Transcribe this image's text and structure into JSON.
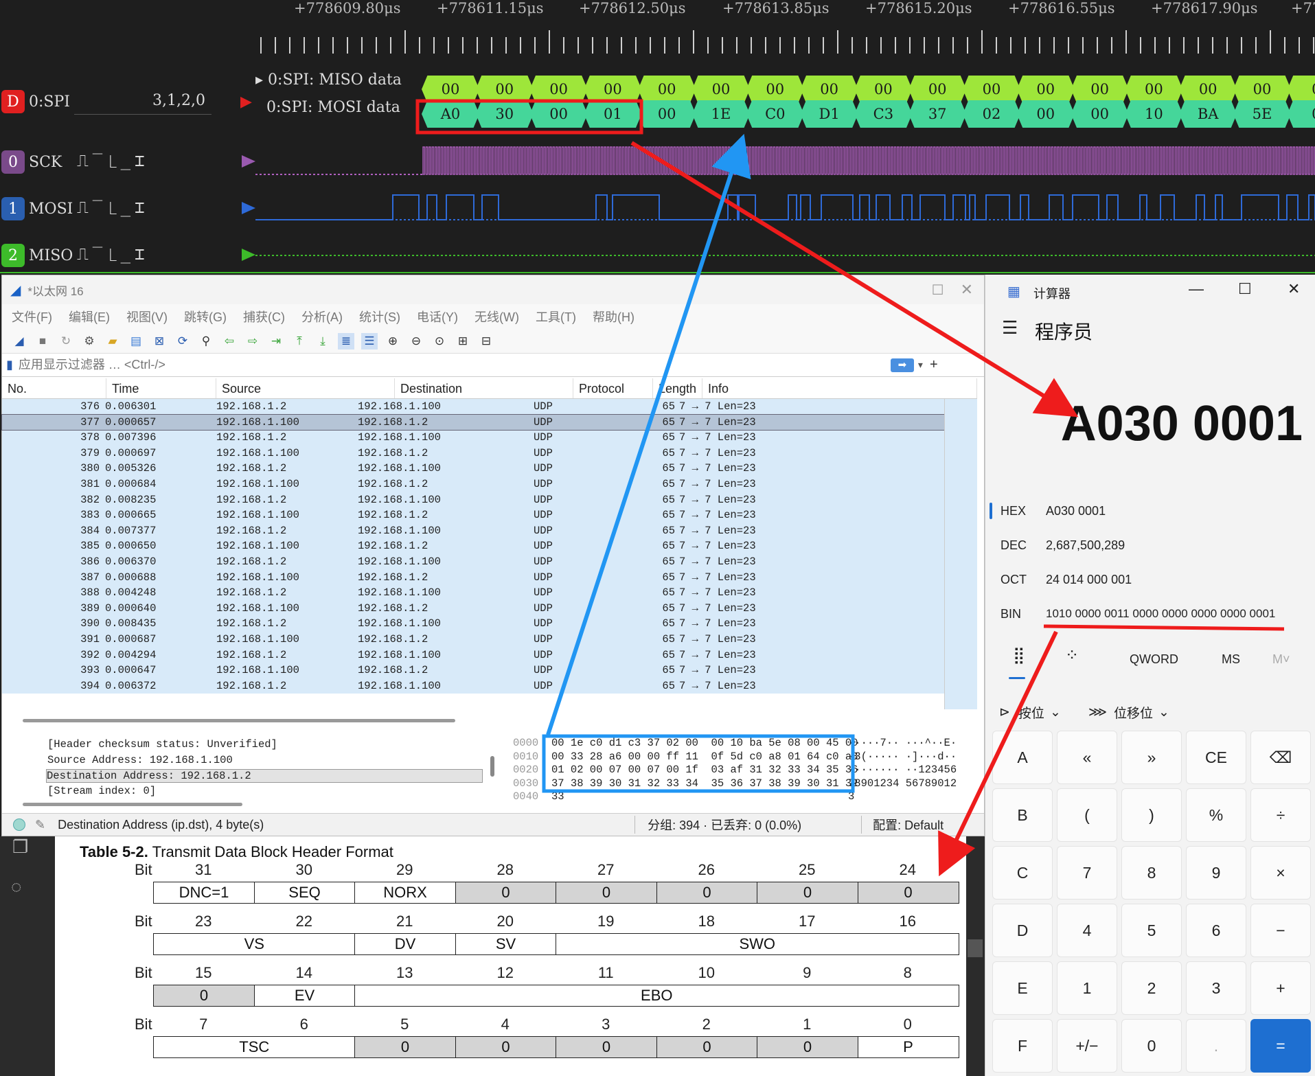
{
  "logic_analyzer": {
    "ticks": [
      "+778609.80μs",
      "+778611.15μs",
      "+778612.50μs",
      "+778613.85μs",
      "+778615.20μs",
      "+778616.55μs",
      "+778617.90μs",
      "+77"
    ],
    "spi_channel": {
      "badge": "D",
      "name": "0:SPI",
      "order": "3,1,2,0",
      "color": "#e02020"
    },
    "decoder_rows": [
      {
        "label": "0:SPI: MISO data",
        "values": [
          "00",
          "00",
          "00",
          "00",
          "00",
          "00",
          "00",
          "00",
          "00",
          "00",
          "00",
          "00",
          "00",
          "00",
          "00",
          "00",
          "0"
        ]
      },
      {
        "label": "0:SPI: MOSI data",
        "values": [
          "A0",
          "30",
          "00",
          "01",
          "00",
          "1E",
          "C0",
          "D1",
          "C3",
          "37",
          "02",
          "00",
          "00",
          "10",
          "BA",
          "5E",
          "0"
        ]
      }
    ],
    "channels": [
      {
        "badge": "0",
        "name": "SCK",
        "color": "#7a4a8a",
        "trace": "#b060c0"
      },
      {
        "badge": "1",
        "name": "MOSI",
        "color": "#2a5fb0",
        "trace": "#2e6ad8"
      },
      {
        "badge": "2",
        "name": "MISO",
        "color": "#3dbb2a",
        "trace": "#3dbb2a"
      }
    ]
  },
  "wireshark": {
    "title": "*以太网 16",
    "menu": [
      "文件(F)",
      "编辑(E)",
      "视图(V)",
      "跳转(G)",
      "捕获(C)",
      "分析(A)",
      "统计(S)",
      "电话(Y)",
      "无线(W)",
      "工具(T)",
      "帮助(H)"
    ],
    "filter_placeholder": "应用显示过滤器 … <Ctrl-/>",
    "columns": [
      "No.",
      "Time",
      "Source",
      "Destination",
      "Protocol",
      "Length",
      "Info"
    ],
    "packets": [
      {
        "no": "376",
        "time": "0.006301",
        "src": "192.168.1.2",
        "dst": "192.168.1.100",
        "proto": "UDP",
        "len": "65",
        "info": "7 → 7 Len=23"
      },
      {
        "no": "377",
        "time": "0.000657",
        "src": "192.168.1.100",
        "dst": "192.168.1.2",
        "proto": "UDP",
        "len": "65",
        "info": "7 → 7 Len=23"
      },
      {
        "no": "378",
        "time": "0.007396",
        "src": "192.168.1.2",
        "dst": "192.168.1.100",
        "proto": "UDP",
        "len": "65",
        "info": "7 → 7 Len=23"
      },
      {
        "no": "379",
        "time": "0.000697",
        "src": "192.168.1.100",
        "dst": "192.168.1.2",
        "proto": "UDP",
        "len": "65",
        "info": "7 → 7 Len=23"
      },
      {
        "no": "380",
        "time": "0.005326",
        "src": "192.168.1.2",
        "dst": "192.168.1.100",
        "proto": "UDP",
        "len": "65",
        "info": "7 → 7 Len=23"
      },
      {
        "no": "381",
        "time": "0.000684",
        "src": "192.168.1.100",
        "dst": "192.168.1.2",
        "proto": "UDP",
        "len": "65",
        "info": "7 → 7 Len=23"
      },
      {
        "no": "382",
        "time": "0.008235",
        "src": "192.168.1.2",
        "dst": "192.168.1.100",
        "proto": "UDP",
        "len": "65",
        "info": "7 → 7 Len=23"
      },
      {
        "no": "383",
        "time": "0.000665",
        "src": "192.168.1.100",
        "dst": "192.168.1.2",
        "proto": "UDP",
        "len": "65",
        "info": "7 → 7 Len=23"
      },
      {
        "no": "384",
        "time": "0.007377",
        "src": "192.168.1.2",
        "dst": "192.168.1.100",
        "proto": "UDP",
        "len": "65",
        "info": "7 → 7 Len=23"
      },
      {
        "no": "385",
        "time": "0.000650",
        "src": "192.168.1.100",
        "dst": "192.168.1.2",
        "proto": "UDP",
        "len": "65",
        "info": "7 → 7 Len=23"
      },
      {
        "no": "386",
        "time": "0.006370",
        "src": "192.168.1.2",
        "dst": "192.168.1.100",
        "proto": "UDP",
        "len": "65",
        "info": "7 → 7 Len=23"
      },
      {
        "no": "387",
        "time": "0.000688",
        "src": "192.168.1.100",
        "dst": "192.168.1.2",
        "proto": "UDP",
        "len": "65",
        "info": "7 → 7 Len=23"
      },
      {
        "no": "388",
        "time": "0.004248",
        "src": "192.168.1.2",
        "dst": "192.168.1.100",
        "proto": "UDP",
        "len": "65",
        "info": "7 → 7 Len=23"
      },
      {
        "no": "389",
        "time": "0.000640",
        "src": "192.168.1.100",
        "dst": "192.168.1.2",
        "proto": "UDP",
        "len": "65",
        "info": "7 → 7 Len=23"
      },
      {
        "no": "390",
        "time": "0.008435",
        "src": "192.168.1.2",
        "dst": "192.168.1.100",
        "proto": "UDP",
        "len": "65",
        "info": "7 → 7 Len=23"
      },
      {
        "no": "391",
        "time": "0.000687",
        "src": "192.168.1.100",
        "dst": "192.168.1.2",
        "proto": "UDP",
        "len": "65",
        "info": "7 → 7 Len=23"
      },
      {
        "no": "392",
        "time": "0.004294",
        "src": "192.168.1.2",
        "dst": "192.168.1.100",
        "proto": "UDP",
        "len": "65",
        "info": "7 → 7 Len=23"
      },
      {
        "no": "393",
        "time": "0.000647",
        "src": "192.168.1.100",
        "dst": "192.168.1.2",
        "proto": "UDP",
        "len": "65",
        "info": "7 → 7 Len=23"
      },
      {
        "no": "394",
        "time": "0.006372",
        "src": "192.168.1.2",
        "dst": "192.168.1.100",
        "proto": "UDP",
        "len": "65",
        "info": "7 → 7 Len=23"
      }
    ],
    "selected_no": "377",
    "detail_lines": [
      "[Header checksum status: Unverified]",
      "Source Address: 192.168.1.100",
      "Destination Address: 192.168.1.2",
      "[Stream index: 0]"
    ],
    "hex_offsets": [
      "0000",
      "0010",
      "0020",
      "0030",
      "0040"
    ],
    "hex_bytes": [
      "00 1e c0 d1 c3 37 02 00  00 10 ba 5e 08 00 45 00",
      "00 33 28 a6 00 00 ff 11  0f 5d c0 a8 01 64 c0 a8",
      "01 02 00 07 00 07 00 1f  03 af 31 32 33 34 35 36",
      "37 38 39 30 31 32 33 34  35 36 37 38 39 30 31 32",
      "33"
    ],
    "hex_ascii": [
      "·····7·· ···^··E·",
      "·3(····· ·]···d··",
      "········ ··123456",
      "78901234 56789012",
      "3"
    ],
    "status_field": "Destination Address (ip.dst), 4 byte(s)",
    "status_counts": "分组: 394 · 已丢弃: 0 (0.0%)",
    "status_profile": "配置: Default"
  },
  "calculator": {
    "title": "计算器",
    "mode": "程序员",
    "display": "A030 0001",
    "radix": [
      {
        "label": "HEX",
        "value": "A030 0001",
        "active": true
      },
      {
        "label": "DEC",
        "value": "2,687,500,289"
      },
      {
        "label": "OCT",
        "value": "24 014 000 001"
      },
      {
        "label": "BIN",
        "value": "1010 0000 0011 0000 0000 0000 0000 0001"
      }
    ],
    "word_size": "QWORD",
    "ms": "MS",
    "mdrop": "M˅",
    "bitwise": "按位",
    "shift": "位移位",
    "keys": [
      [
        "A",
        "«",
        "»",
        "CE",
        "⌫"
      ],
      [
        "B",
        "(",
        ")",
        "%",
        "÷"
      ],
      [
        "C",
        "7",
        "8",
        "9",
        "×"
      ],
      [
        "D",
        "4",
        "5",
        "6",
        "−"
      ],
      [
        "E",
        "1",
        "2",
        "3",
        "+"
      ],
      [
        "F",
        "+/−",
        "0",
        ".",
        "="
      ]
    ]
  },
  "pdf": {
    "caption_bold": "Table 5-2.",
    "caption_rest": " Transmit Data Block Header Format",
    "bit_label": "Bit",
    "rows": [
      {
        "bits": [
          "31",
          "30",
          "29",
          "28",
          "27",
          "26",
          "25",
          "24"
        ],
        "cells": [
          {
            "t": "DNC=1",
            "s": 1
          },
          {
            "t": "SEQ",
            "s": 1
          },
          {
            "t": "NORX",
            "s": 1
          },
          {
            "t": "0",
            "s": 1,
            "g": true
          },
          {
            "t": "0",
            "s": 1,
            "g": true
          },
          {
            "t": "0",
            "s": 1,
            "g": true
          },
          {
            "t": "0",
            "s": 1,
            "g": true
          },
          {
            "t": "0",
            "s": 1,
            "g": true
          }
        ]
      },
      {
        "bits": [
          "23",
          "22",
          "21",
          "20",
          "19",
          "18",
          "17",
          "16"
        ],
        "cells": [
          {
            "t": "VS",
            "s": 2
          },
          {
            "t": "DV",
            "s": 1
          },
          {
            "t": "SV",
            "s": 1
          },
          {
            "t": "SWO",
            "s": 4
          }
        ]
      },
      {
        "bits": [
          "15",
          "14",
          "13",
          "12",
          "11",
          "10",
          "9",
          "8"
        ],
        "cells": [
          {
            "t": "0",
            "s": 1,
            "g": true
          },
          {
            "t": "EV",
            "s": 1
          },
          {
            "t": "EBO",
            "s": 6
          }
        ]
      },
      {
        "bits": [
          "7",
          "6",
          "5",
          "4",
          "3",
          "2",
          "1",
          "0"
        ],
        "cells": [
          {
            "t": "TSC",
            "s": 2
          },
          {
            "t": "0",
            "s": 1,
            "g": true
          },
          {
            "t": "0",
            "s": 1,
            "g": true
          },
          {
            "t": "0",
            "s": 1,
            "g": true
          },
          {
            "t": "0",
            "s": 1,
            "g": true
          },
          {
            "t": "0",
            "s": 1,
            "g": true
          },
          {
            "t": "P",
            "s": 1
          }
        ]
      }
    ]
  }
}
